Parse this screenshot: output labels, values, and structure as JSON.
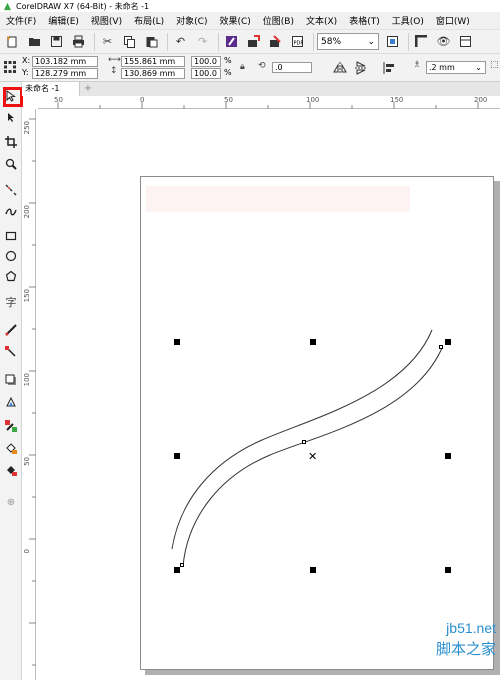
{
  "window": {
    "title": "CorelDRAW X7 (64-Bit) - 未命名 -1"
  },
  "menu": [
    "文件(F)",
    "编辑(E)",
    "视图(V)",
    "布局(L)",
    "对象(C)",
    "效果(C)",
    "位图(B)",
    "文本(X)",
    "表格(T)",
    "工具(O)",
    "窗口(W)"
  ],
  "toolbar": {
    "zoom_value": "58%"
  },
  "properties": {
    "x": "103.182 mm",
    "y": "128.279 mm",
    "width": "155.861 mm",
    "height": "130.869 mm",
    "scale_x": "100.0",
    "scale_y": "100.0",
    "percent": "%",
    "rotation": ".0",
    "outline_width": ".2 mm"
  },
  "tabs": {
    "document": "未命名 -1",
    "add": "+"
  },
  "ruler": {
    "h_labels": [
      "50",
      "0",
      "50",
      "100",
      "150",
      "200"
    ],
    "v_labels": [
      "250",
      "200",
      "150",
      "100",
      "50",
      "0"
    ]
  },
  "watermark": {
    "site": "jb51.net",
    "name": "脚本之家"
  }
}
